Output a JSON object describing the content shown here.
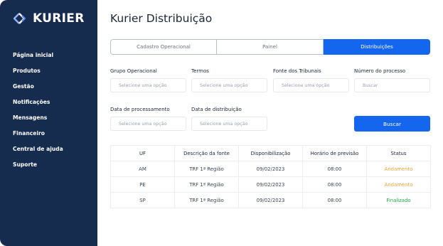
{
  "app": {
    "logo_text": "KURIER",
    "accent": "#1566ee",
    "sidebar_bg": "#152c4e"
  },
  "sidebar": {
    "items": [
      {
        "label": "Página inicial"
      },
      {
        "label": "Produtos"
      },
      {
        "label": "Gestão"
      },
      {
        "label": "Notificações"
      },
      {
        "label": "Mensagens"
      },
      {
        "label": "Financeiro"
      },
      {
        "label": "Central de ajuda"
      },
      {
        "label": "Suporte"
      }
    ]
  },
  "main": {
    "title": "Kurier Distribuição",
    "tabs": [
      {
        "label": "Cadastro Operacional",
        "active": false
      },
      {
        "label": "Painel",
        "active": false
      },
      {
        "label": "Distribuições",
        "active": true
      }
    ],
    "filters": {
      "grupo": {
        "label": "Grupo Operacional",
        "placeholder": "Selecione uma opção"
      },
      "termos": {
        "label": "Termos",
        "placeholder": "Selecione uma opção"
      },
      "fonte": {
        "label": "Fonte dos Tribunais",
        "placeholder": "Selecione uma opção"
      },
      "numero": {
        "label": "Número do processo",
        "placeholder": "Buscar"
      },
      "data_proc": {
        "label": "Data de processamento",
        "placeholder": "Selecione uma opção"
      },
      "data_dist": {
        "label": "Data de distribuição",
        "placeholder": "Selecione uma opção"
      }
    },
    "search_button": "Buscar",
    "table": {
      "headers": [
        "UF",
        "Descrição da fonte",
        "Disponibilização",
        "Horário de previsão",
        "Status"
      ],
      "rows": [
        [
          "AM",
          "TRF 1ª Região",
          "09/02/2023",
          "08:00",
          "Andamento"
        ],
        [
          "PE",
          "TRF 1ª Região",
          "09/02/2023",
          "08:00",
          "Andamento"
        ],
        [
          "SP",
          "TRF 1ª Região",
          "09/02/2023",
          "08:00",
          "Finalizado"
        ]
      ]
    },
    "status_colors": {
      "Andamento": "#e5a53c",
      "Finalizado": "#27a84a"
    }
  }
}
